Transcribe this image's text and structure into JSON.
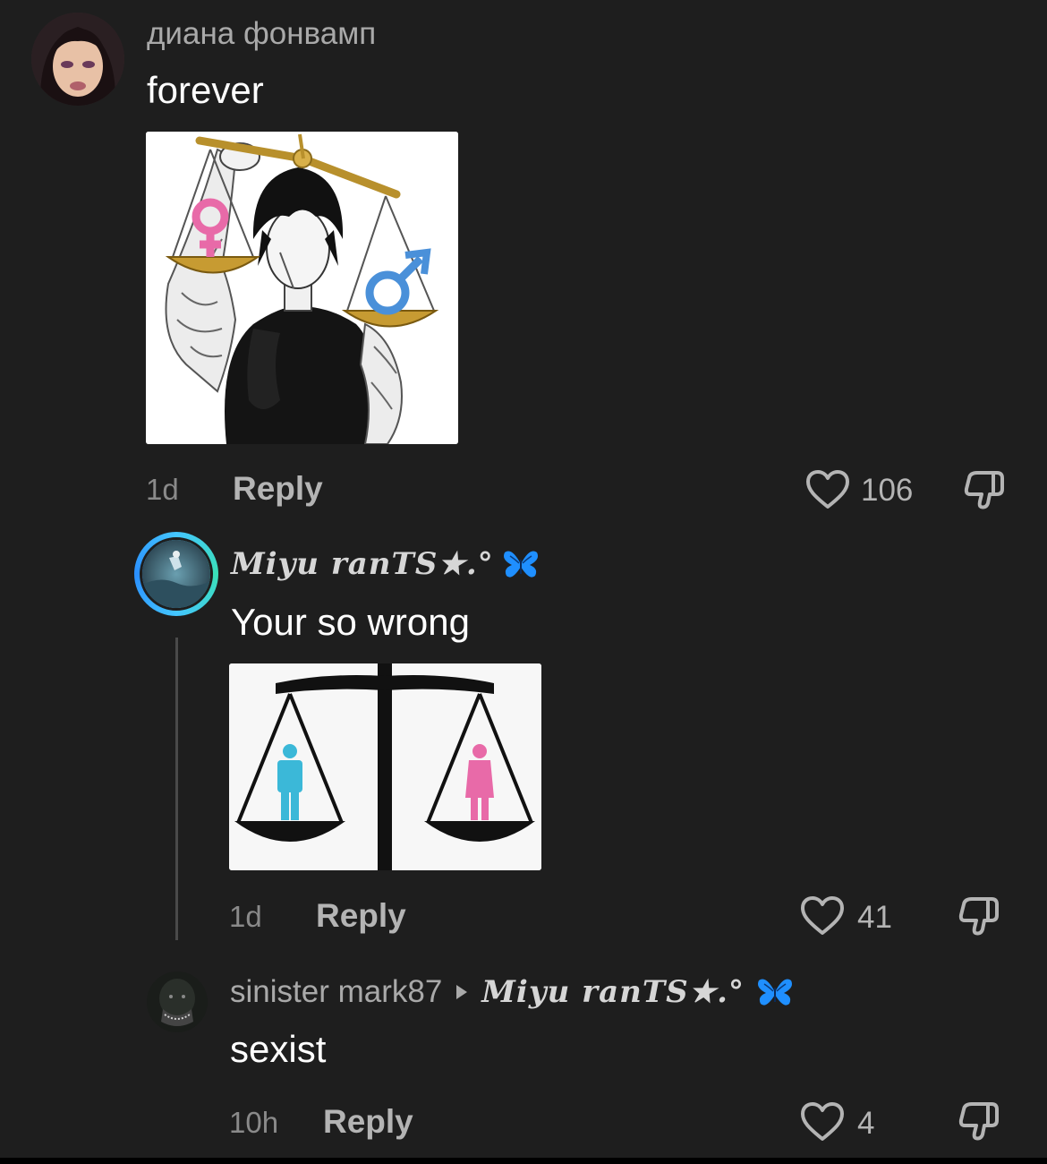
{
  "comments": [
    {
      "username": "диана фонвамп",
      "text": "forever",
      "time": "1d",
      "reply_label": "Reply",
      "likes": "106"
    },
    {
      "username": "Miyu ranTS★.°",
      "text": "Your so wrong",
      "time": "1d",
      "reply_label": "Reply",
      "likes": "41"
    },
    {
      "username": "sinister mark87",
      "reply_to": "Miyu ranTS★.°",
      "text": "sexist",
      "time": "10h",
      "reply_label": "Reply",
      "likes": "4"
    }
  ],
  "icons": {
    "like": "heart-outline-icon",
    "dislike": "thumbs-down-icon",
    "reply_arrow": "triangle-right-icon",
    "badge": "blue-butterfly-icon"
  },
  "colors": {
    "background": "#1e1e1e",
    "butterfly": "#1f8fff",
    "female_pink": "#e86aa8",
    "male_blue": "#4a90d9",
    "cyan_figure": "#3bb8d8",
    "story_ring": "#44c6ff"
  }
}
